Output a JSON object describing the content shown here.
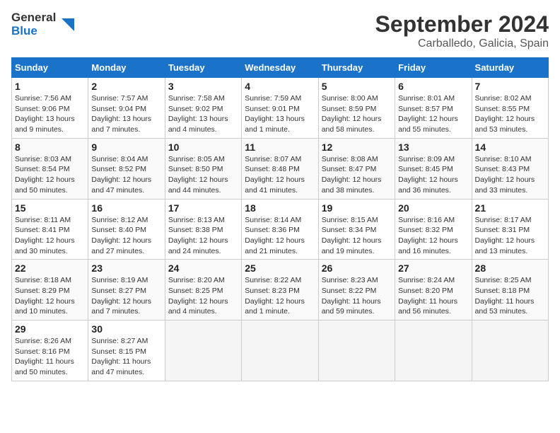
{
  "logo": {
    "line1": "General",
    "line2": "Blue"
  },
  "title": "September 2024",
  "location": "Carballedo, Galicia, Spain",
  "days_of_week": [
    "Sunday",
    "Monday",
    "Tuesday",
    "Wednesday",
    "Thursday",
    "Friday",
    "Saturday"
  ],
  "weeks": [
    [
      {
        "day": "1",
        "info": "Sunrise: 7:56 AM\nSunset: 9:06 PM\nDaylight: 13 hours and 9 minutes."
      },
      {
        "day": "2",
        "info": "Sunrise: 7:57 AM\nSunset: 9:04 PM\nDaylight: 13 hours and 7 minutes."
      },
      {
        "day": "3",
        "info": "Sunrise: 7:58 AM\nSunset: 9:02 PM\nDaylight: 13 hours and 4 minutes."
      },
      {
        "day": "4",
        "info": "Sunrise: 7:59 AM\nSunset: 9:01 PM\nDaylight: 13 hours and 1 minute."
      },
      {
        "day": "5",
        "info": "Sunrise: 8:00 AM\nSunset: 8:59 PM\nDaylight: 12 hours and 58 minutes."
      },
      {
        "day": "6",
        "info": "Sunrise: 8:01 AM\nSunset: 8:57 PM\nDaylight: 12 hours and 55 minutes."
      },
      {
        "day": "7",
        "info": "Sunrise: 8:02 AM\nSunset: 8:55 PM\nDaylight: 12 hours and 53 minutes."
      }
    ],
    [
      {
        "day": "8",
        "info": "Sunrise: 8:03 AM\nSunset: 8:54 PM\nDaylight: 12 hours and 50 minutes."
      },
      {
        "day": "9",
        "info": "Sunrise: 8:04 AM\nSunset: 8:52 PM\nDaylight: 12 hours and 47 minutes."
      },
      {
        "day": "10",
        "info": "Sunrise: 8:05 AM\nSunset: 8:50 PM\nDaylight: 12 hours and 44 minutes."
      },
      {
        "day": "11",
        "info": "Sunrise: 8:07 AM\nSunset: 8:48 PM\nDaylight: 12 hours and 41 minutes."
      },
      {
        "day": "12",
        "info": "Sunrise: 8:08 AM\nSunset: 8:47 PM\nDaylight: 12 hours and 38 minutes."
      },
      {
        "day": "13",
        "info": "Sunrise: 8:09 AM\nSunset: 8:45 PM\nDaylight: 12 hours and 36 minutes."
      },
      {
        "day": "14",
        "info": "Sunrise: 8:10 AM\nSunset: 8:43 PM\nDaylight: 12 hours and 33 minutes."
      }
    ],
    [
      {
        "day": "15",
        "info": "Sunrise: 8:11 AM\nSunset: 8:41 PM\nDaylight: 12 hours and 30 minutes."
      },
      {
        "day": "16",
        "info": "Sunrise: 8:12 AM\nSunset: 8:40 PM\nDaylight: 12 hours and 27 minutes."
      },
      {
        "day": "17",
        "info": "Sunrise: 8:13 AM\nSunset: 8:38 PM\nDaylight: 12 hours and 24 minutes."
      },
      {
        "day": "18",
        "info": "Sunrise: 8:14 AM\nSunset: 8:36 PM\nDaylight: 12 hours and 21 minutes."
      },
      {
        "day": "19",
        "info": "Sunrise: 8:15 AM\nSunset: 8:34 PM\nDaylight: 12 hours and 19 minutes."
      },
      {
        "day": "20",
        "info": "Sunrise: 8:16 AM\nSunset: 8:32 PM\nDaylight: 12 hours and 16 minutes."
      },
      {
        "day": "21",
        "info": "Sunrise: 8:17 AM\nSunset: 8:31 PM\nDaylight: 12 hours and 13 minutes."
      }
    ],
    [
      {
        "day": "22",
        "info": "Sunrise: 8:18 AM\nSunset: 8:29 PM\nDaylight: 12 hours and 10 minutes."
      },
      {
        "day": "23",
        "info": "Sunrise: 8:19 AM\nSunset: 8:27 PM\nDaylight: 12 hours and 7 minutes."
      },
      {
        "day": "24",
        "info": "Sunrise: 8:20 AM\nSunset: 8:25 PM\nDaylight: 12 hours and 4 minutes."
      },
      {
        "day": "25",
        "info": "Sunrise: 8:22 AM\nSunset: 8:23 PM\nDaylight: 12 hours and 1 minute."
      },
      {
        "day": "26",
        "info": "Sunrise: 8:23 AM\nSunset: 8:22 PM\nDaylight: 11 hours and 59 minutes."
      },
      {
        "day": "27",
        "info": "Sunrise: 8:24 AM\nSunset: 8:20 PM\nDaylight: 11 hours and 56 minutes."
      },
      {
        "day": "28",
        "info": "Sunrise: 8:25 AM\nSunset: 8:18 PM\nDaylight: 11 hours and 53 minutes."
      }
    ],
    [
      {
        "day": "29",
        "info": "Sunrise: 8:26 AM\nSunset: 8:16 PM\nDaylight: 11 hours and 50 minutes."
      },
      {
        "day": "30",
        "info": "Sunrise: 8:27 AM\nSunset: 8:15 PM\nDaylight: 11 hours and 47 minutes."
      },
      {
        "day": "",
        "info": ""
      },
      {
        "day": "",
        "info": ""
      },
      {
        "day": "",
        "info": ""
      },
      {
        "day": "",
        "info": ""
      },
      {
        "day": "",
        "info": ""
      }
    ]
  ]
}
